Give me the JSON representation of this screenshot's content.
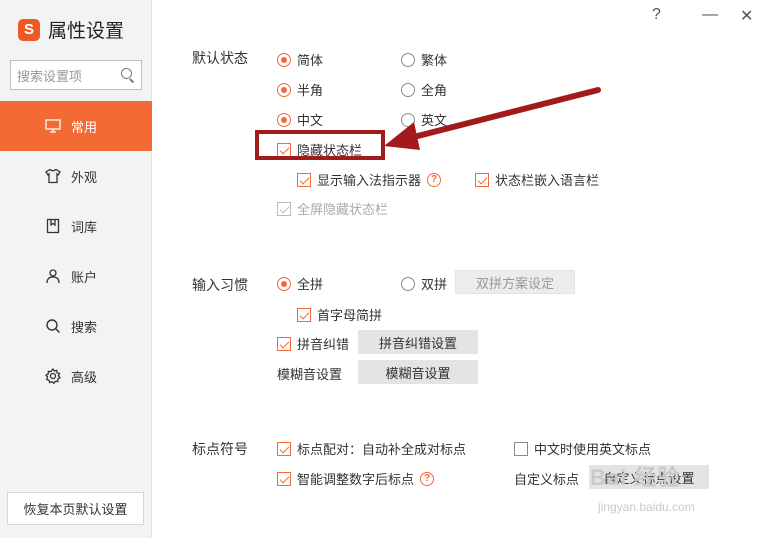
{
  "app": {
    "logo_glyph": "S",
    "title": "属性设置"
  },
  "window_controls": {
    "help": "?",
    "minimize": "—",
    "close": "✕"
  },
  "search": {
    "placeholder": "搜索设置项"
  },
  "sidebar": {
    "items": [
      {
        "label": "常用",
        "icon": "monitor-icon",
        "active": true
      },
      {
        "label": "外观",
        "icon": "shirt-icon",
        "active": false
      },
      {
        "label": "词库",
        "icon": "book-icon",
        "active": false
      },
      {
        "label": "账户",
        "icon": "user-icon",
        "active": false
      },
      {
        "label": "搜索",
        "icon": "search-icon",
        "active": false
      },
      {
        "label": "高级",
        "icon": "gear-icon",
        "active": false
      }
    ],
    "reset_label": "恢复本页默认设置"
  },
  "default_state": {
    "label": "默认状态",
    "simplified": "简体",
    "traditional": "繁体",
    "half_width": "半角",
    "full_width": "全角",
    "chinese": "中文",
    "english": "英文",
    "hide_status_bar": "隐藏状态栏",
    "show_indicator": "显示输入法指示器",
    "embed_language_bar": "状态栏嵌入语言栏",
    "fullscreen_hide": "全屏隐藏状态栏"
  },
  "input_habit": {
    "label": "输入习惯",
    "full_pinyin": "全拼",
    "double_pinyin": "双拼",
    "double_scheme_button": "双拼方案设定",
    "initials_abbrev": "首字母简拼",
    "pinyin_correction": "拼音纠错",
    "pinyin_correction_button": "拼音纠错设置",
    "fuzzy_label": "模糊音设置",
    "fuzzy_button": "模糊音设置"
  },
  "punctuation": {
    "label": "标点符号",
    "auto_pair": "标点配对：自动补全成对标点",
    "english_punct_in_chinese": "中文时使用英文标点",
    "smart_after_digits": "智能调整数字后标点",
    "custom_label": "自定义标点",
    "custom_button": "自定义标点设置"
  },
  "watermark": {
    "brand": "Bai 经验",
    "url": "jingyan.baidu.com"
  },
  "colors": {
    "accent": "#f36a35",
    "annotation": "#a31a1a"
  }
}
